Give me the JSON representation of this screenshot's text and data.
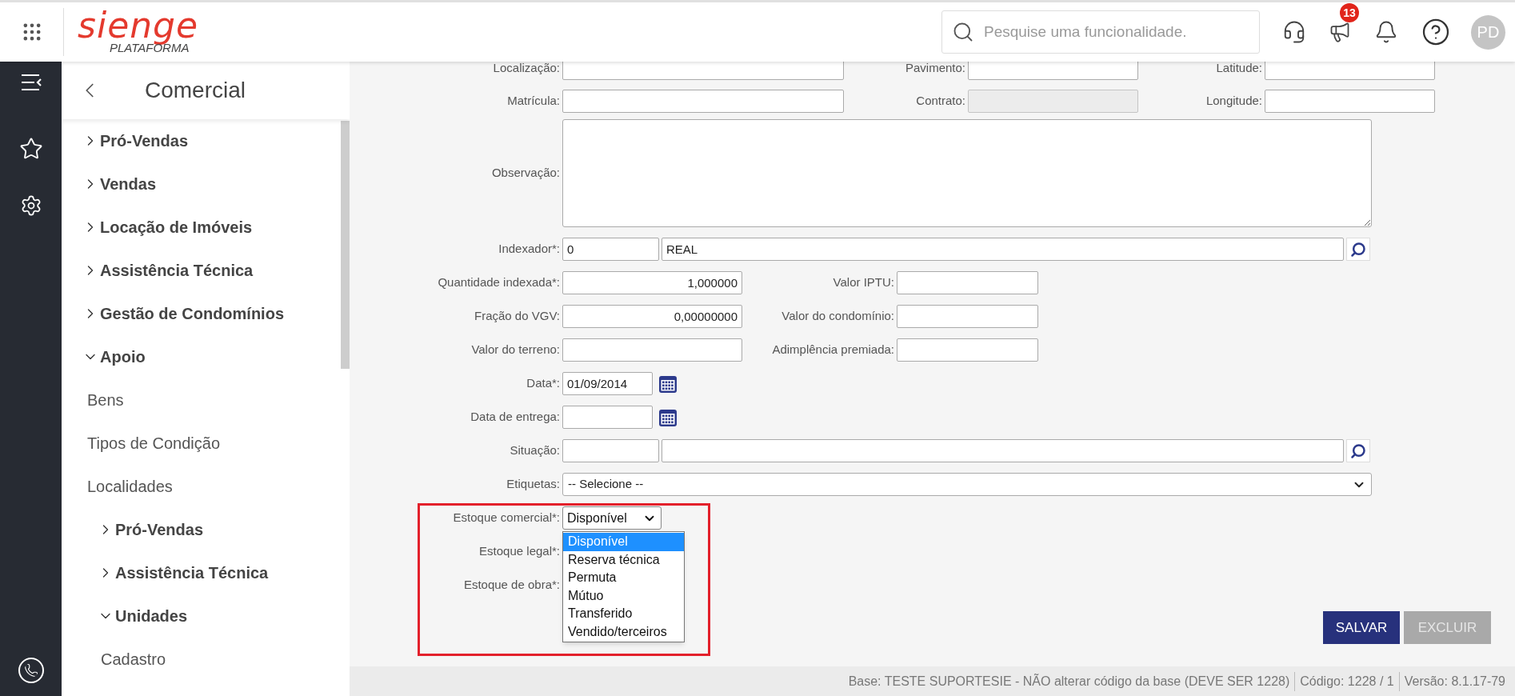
{
  "header": {
    "logo": "sienge",
    "logo_subtitle": "PLATAFORMA",
    "search": {
      "placeholder": "Pesquise uma funcionalidade."
    },
    "notifications_badge": "13",
    "avatar": "PD"
  },
  "sidebar": {
    "title": "Comercial",
    "items": [
      {
        "label": "Pró-Vendas",
        "kind": "group",
        "expanded": false
      },
      {
        "label": "Vendas",
        "kind": "group",
        "expanded": false
      },
      {
        "label": "Locação de Imóveis",
        "kind": "group",
        "expanded": false
      },
      {
        "label": "Assistência Técnica",
        "kind": "group",
        "expanded": false
      },
      {
        "label": "Gestão de Condomínios",
        "kind": "group",
        "expanded": false
      },
      {
        "label": "Apoio",
        "kind": "group",
        "expanded": true,
        "children": [
          {
            "label": "Bens",
            "kind": "link"
          },
          {
            "label": "Tipos de Condição",
            "kind": "link"
          },
          {
            "label": "Localidades",
            "kind": "link"
          },
          {
            "label": "Pró-Vendas",
            "kind": "group",
            "expanded": false
          },
          {
            "label": "Assistência Técnica",
            "kind": "group",
            "expanded": false
          },
          {
            "label": "Unidades",
            "kind": "group",
            "expanded": true,
            "children": [
              {
                "label": "Cadastro",
                "kind": "link"
              }
            ]
          }
        ]
      }
    ]
  },
  "form": {
    "rows": [
      {
        "kind": "triple",
        "fields": [
          {
            "label": "Localização:",
            "disabled": false
          },
          {
            "label": "Pavimento:",
            "disabled": false
          },
          {
            "label": "Latitude:",
            "disabled": false
          }
        ]
      },
      {
        "kind": "triple",
        "fields": [
          {
            "label": "Matrícula:",
            "disabled": false
          },
          {
            "label": "Contrato:",
            "disabled": true
          },
          {
            "label": "Longitude:",
            "disabled": false
          }
        ]
      },
      {
        "kind": "textarea",
        "label": "Observação:"
      },
      {
        "kind": "lookup",
        "label": "Indexador*:",
        "code": "0",
        "description": "REAL"
      },
      {
        "kind": "pair",
        "fields": [
          {
            "label": "Quantidade indexada*:",
            "value": "1,000000"
          },
          {
            "label": "Valor IPTU:"
          }
        ]
      },
      {
        "kind": "pair",
        "fields": [
          {
            "label": "Fração do VGV:",
            "value": "0,00000000"
          },
          {
            "label": "Valor do condomínio:"
          }
        ]
      },
      {
        "kind": "pair",
        "fields": [
          {
            "label": "Valor do terreno:"
          },
          {
            "label": "Adimplência premiada:"
          }
        ]
      },
      {
        "kind": "date",
        "label": "Data*:",
        "value": "01/09/2014"
      },
      {
        "kind": "date",
        "label": "Data de entrega:"
      },
      {
        "kind": "lookup",
        "label": "Situação:"
      },
      {
        "kind": "select",
        "label": "Etiquetas:",
        "value": "-- Selecione --"
      }
    ]
  },
  "stock_section": {
    "highlighted": true,
    "rows": [
      {
        "kind": "open_select",
        "label": "Estoque comercial*:",
        "value": "Disponível",
        "options": [
          {
            "label": "Disponível",
            "selected": true
          },
          {
            "label": "Reserva técnica",
            "selected": false
          },
          {
            "label": "Permuta",
            "selected": false
          },
          {
            "label": "Mútuo",
            "selected": false
          },
          {
            "label": "Transferido",
            "selected": false
          },
          {
            "label": "Vendido/terceiros",
            "selected": false
          }
        ]
      },
      {
        "kind": "label_only",
        "label": "Estoque legal*:"
      },
      {
        "kind": "label_only",
        "label": "Estoque de obra*:"
      }
    ]
  },
  "buttons": [
    {
      "label": "SALVAR",
      "disabled": false
    },
    {
      "label": "EXCLUIR",
      "disabled": true
    }
  ],
  "status_bar": [
    "Base: TESTE SUPORTESIE - NÃO alterar código da base (DEVE SER 1228)",
    "Código: 1228 / 1",
    "Versão: 8.1.17-79"
  ]
}
